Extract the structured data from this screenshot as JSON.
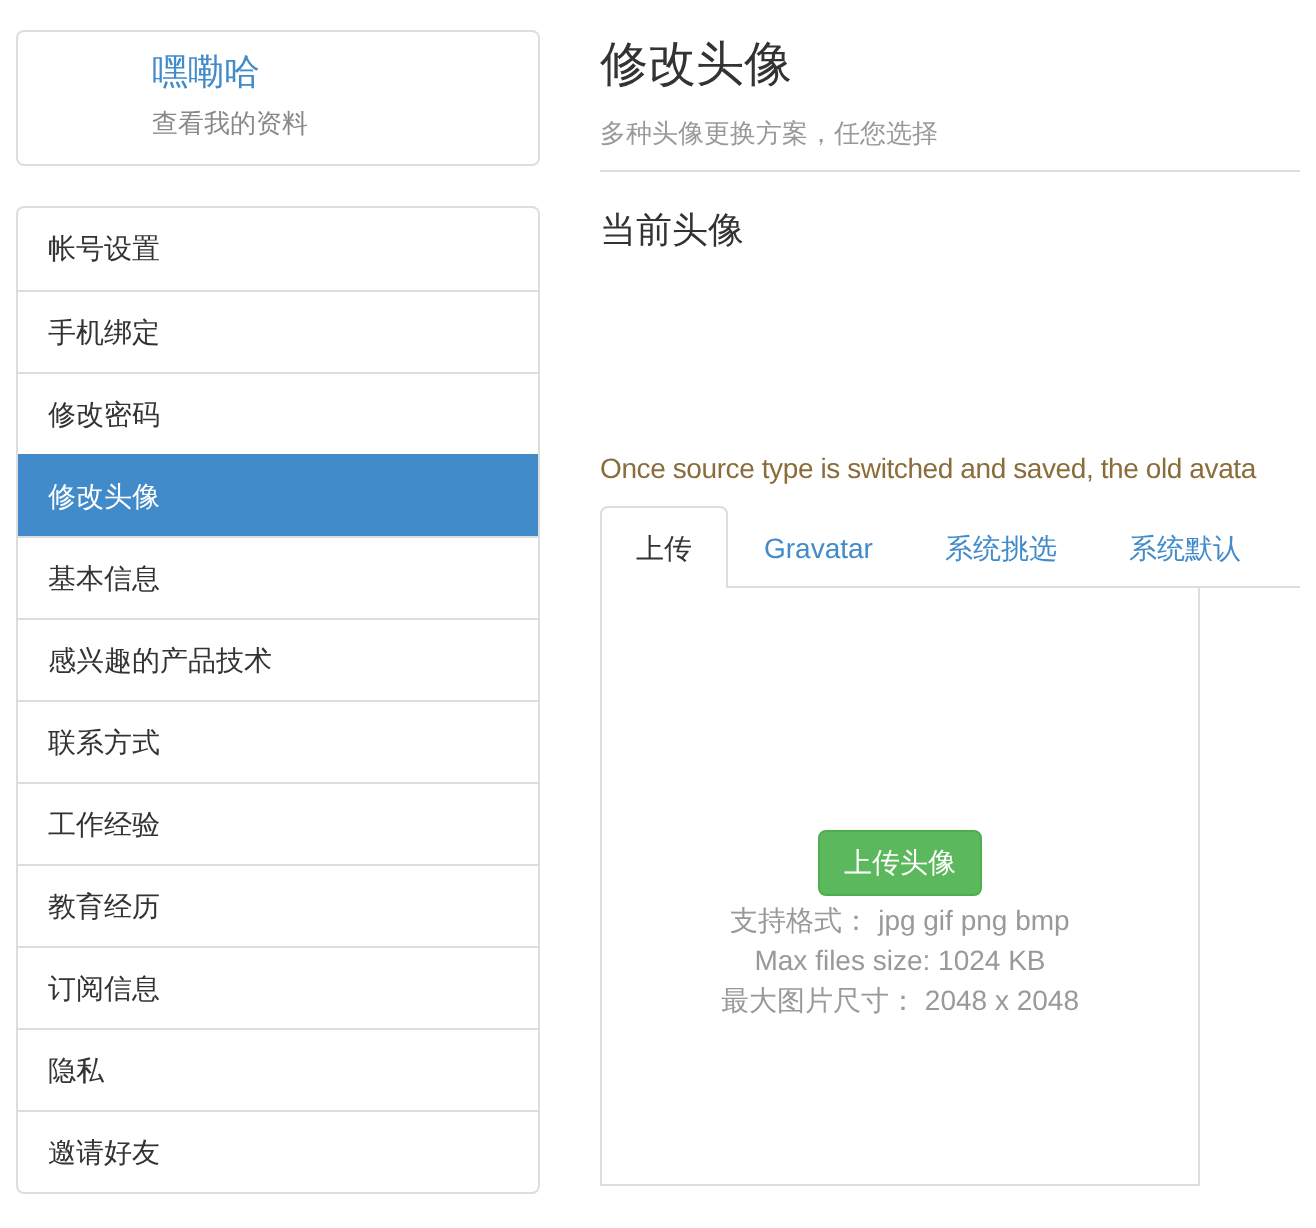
{
  "profile": {
    "name": "嘿嘞哈",
    "link": "查看我的资料"
  },
  "menu": [
    {
      "label": "帐号设置",
      "selected": false
    },
    {
      "label": "手机绑定",
      "selected": false
    },
    {
      "label": "修改密码",
      "selected": false
    },
    {
      "label": "修改头像",
      "selected": true
    },
    {
      "label": "基本信息",
      "selected": false
    },
    {
      "label": "感兴趣的产品技术",
      "selected": false
    },
    {
      "label": "联系方式",
      "selected": false
    },
    {
      "label": "工作经验",
      "selected": false
    },
    {
      "label": "教育经历",
      "selected": false
    },
    {
      "label": "订阅信息",
      "selected": false
    },
    {
      "label": "隐私",
      "selected": false
    },
    {
      "label": "邀请好友",
      "selected": false
    }
  ],
  "header": {
    "title": "修改头像",
    "subtitle": "多种头像更换方案，任您选择"
  },
  "current_avatar": {
    "heading": "当前头像"
  },
  "notice": "Once source type is switched and saved, the old avata",
  "tabs": [
    {
      "label": "上传",
      "selected": true
    },
    {
      "label": "Gravatar",
      "selected": false
    },
    {
      "label": "系统挑选",
      "selected": false
    },
    {
      "label": "系统默认",
      "selected": false
    }
  ],
  "upload": {
    "button": "上传头像",
    "info": [
      "支持格式： jpg gif png bmp",
      "Max files size: 1024 KB",
      "最大图片尺寸： 2048 x 2048"
    ]
  }
}
